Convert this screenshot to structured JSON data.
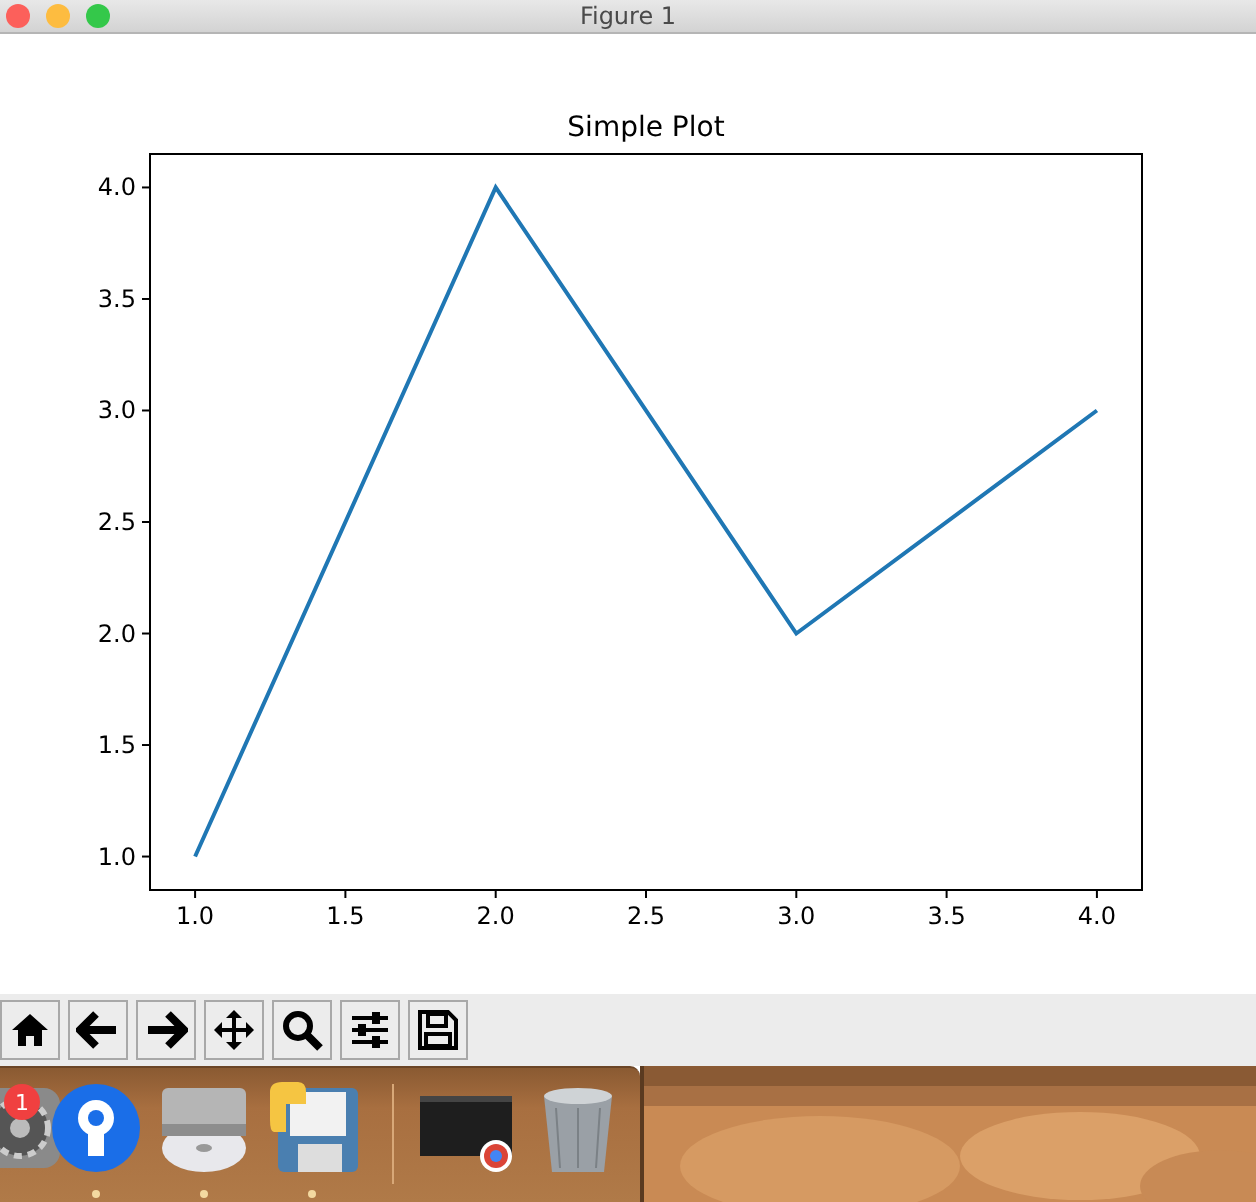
{
  "window": {
    "title": "Figure 1"
  },
  "figure": {
    "chart_data": {
      "type": "line",
      "title": "Simple Plot",
      "x": [
        1,
        2,
        3,
        4
      ],
      "series": [
        {
          "color": "#1f77b4",
          "values": [
            1,
            4,
            2,
            3
          ]
        }
      ],
      "xlim": [
        0.85,
        4.15
      ],
      "ylim": [
        0.85,
        4.15
      ],
      "xticks": [
        {
          "value": 1,
          "label": "1.0"
        },
        {
          "value": 1.5,
          "label": "1.5"
        },
        {
          "value": 2,
          "label": "2.0"
        },
        {
          "value": 2.5,
          "label": "2.5"
        },
        {
          "value": 3,
          "label": "3.0"
        },
        {
          "value": 3.5,
          "label": "3.5"
        },
        {
          "value": 4,
          "label": "4.0"
        }
      ],
      "yticks": [
        {
          "value": 1,
          "label": "1.0"
        },
        {
          "value": 1.5,
          "label": "1.5"
        },
        {
          "value": 2,
          "label": "2.0"
        },
        {
          "value": 2.5,
          "label": "2.5"
        },
        {
          "value": 3,
          "label": "3.0"
        },
        {
          "value": 3.5,
          "label": "3.5"
        },
        {
          "value": 4,
          "label": "4.0"
        }
      ]
    }
  },
  "toolbar": {
    "buttons": [
      {
        "kind": "home"
      },
      {
        "kind": "back"
      },
      {
        "kind": "forward"
      },
      {
        "kind": "pan"
      },
      {
        "kind": "zoom"
      },
      {
        "kind": "configure"
      },
      {
        "kind": "save"
      }
    ]
  },
  "dock": {
    "items": [
      {
        "kind": "settings",
        "badge": "1"
      },
      {
        "kind": "pin",
        "running": true
      },
      {
        "kind": "disc",
        "running": true
      },
      {
        "kind": "python",
        "running": true
      },
      {
        "kind": "separator"
      },
      {
        "kind": "window"
      },
      {
        "kind": "trash"
      }
    ]
  }
}
